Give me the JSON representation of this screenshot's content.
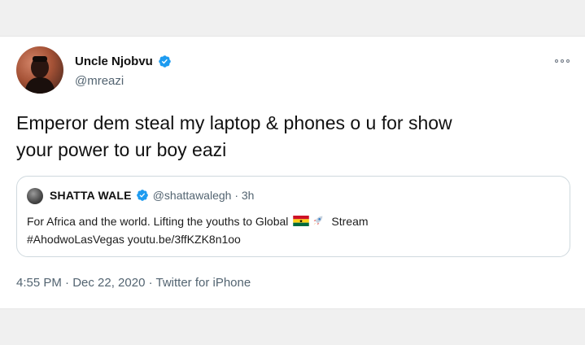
{
  "tweet": {
    "display_name": "Uncle Njobvu",
    "handle": "@mreazi",
    "text_line1": "Emperor dem steal my laptop & phones o u for show",
    "text_line2": "your power to ur boy eazi",
    "timestamp": "4:55 PM · Dec 22, 2020 · Twitter for iPhone",
    "more_icon": "more-options-icon",
    "verified_icon": "verified-badge-icon"
  },
  "quoted": {
    "display_name": "SHATTA WALE",
    "meta": "@shattawalegh · 3h",
    "text_part1": "For Africa and the world. Lifting the youths to Global",
    "emoji_1": "ghana-flag-icon",
    "emoji_2": "rocket-icon",
    "text_part2": "Stream",
    "text_line2": "#AhodwoLasVegas youtu.be/3ffKZK8n1oo"
  },
  "colors": {
    "verified_blue": "#1d9bf0",
    "meta_gray": "#536471",
    "border": "#cfd9de",
    "background": "#f0f0f0"
  }
}
